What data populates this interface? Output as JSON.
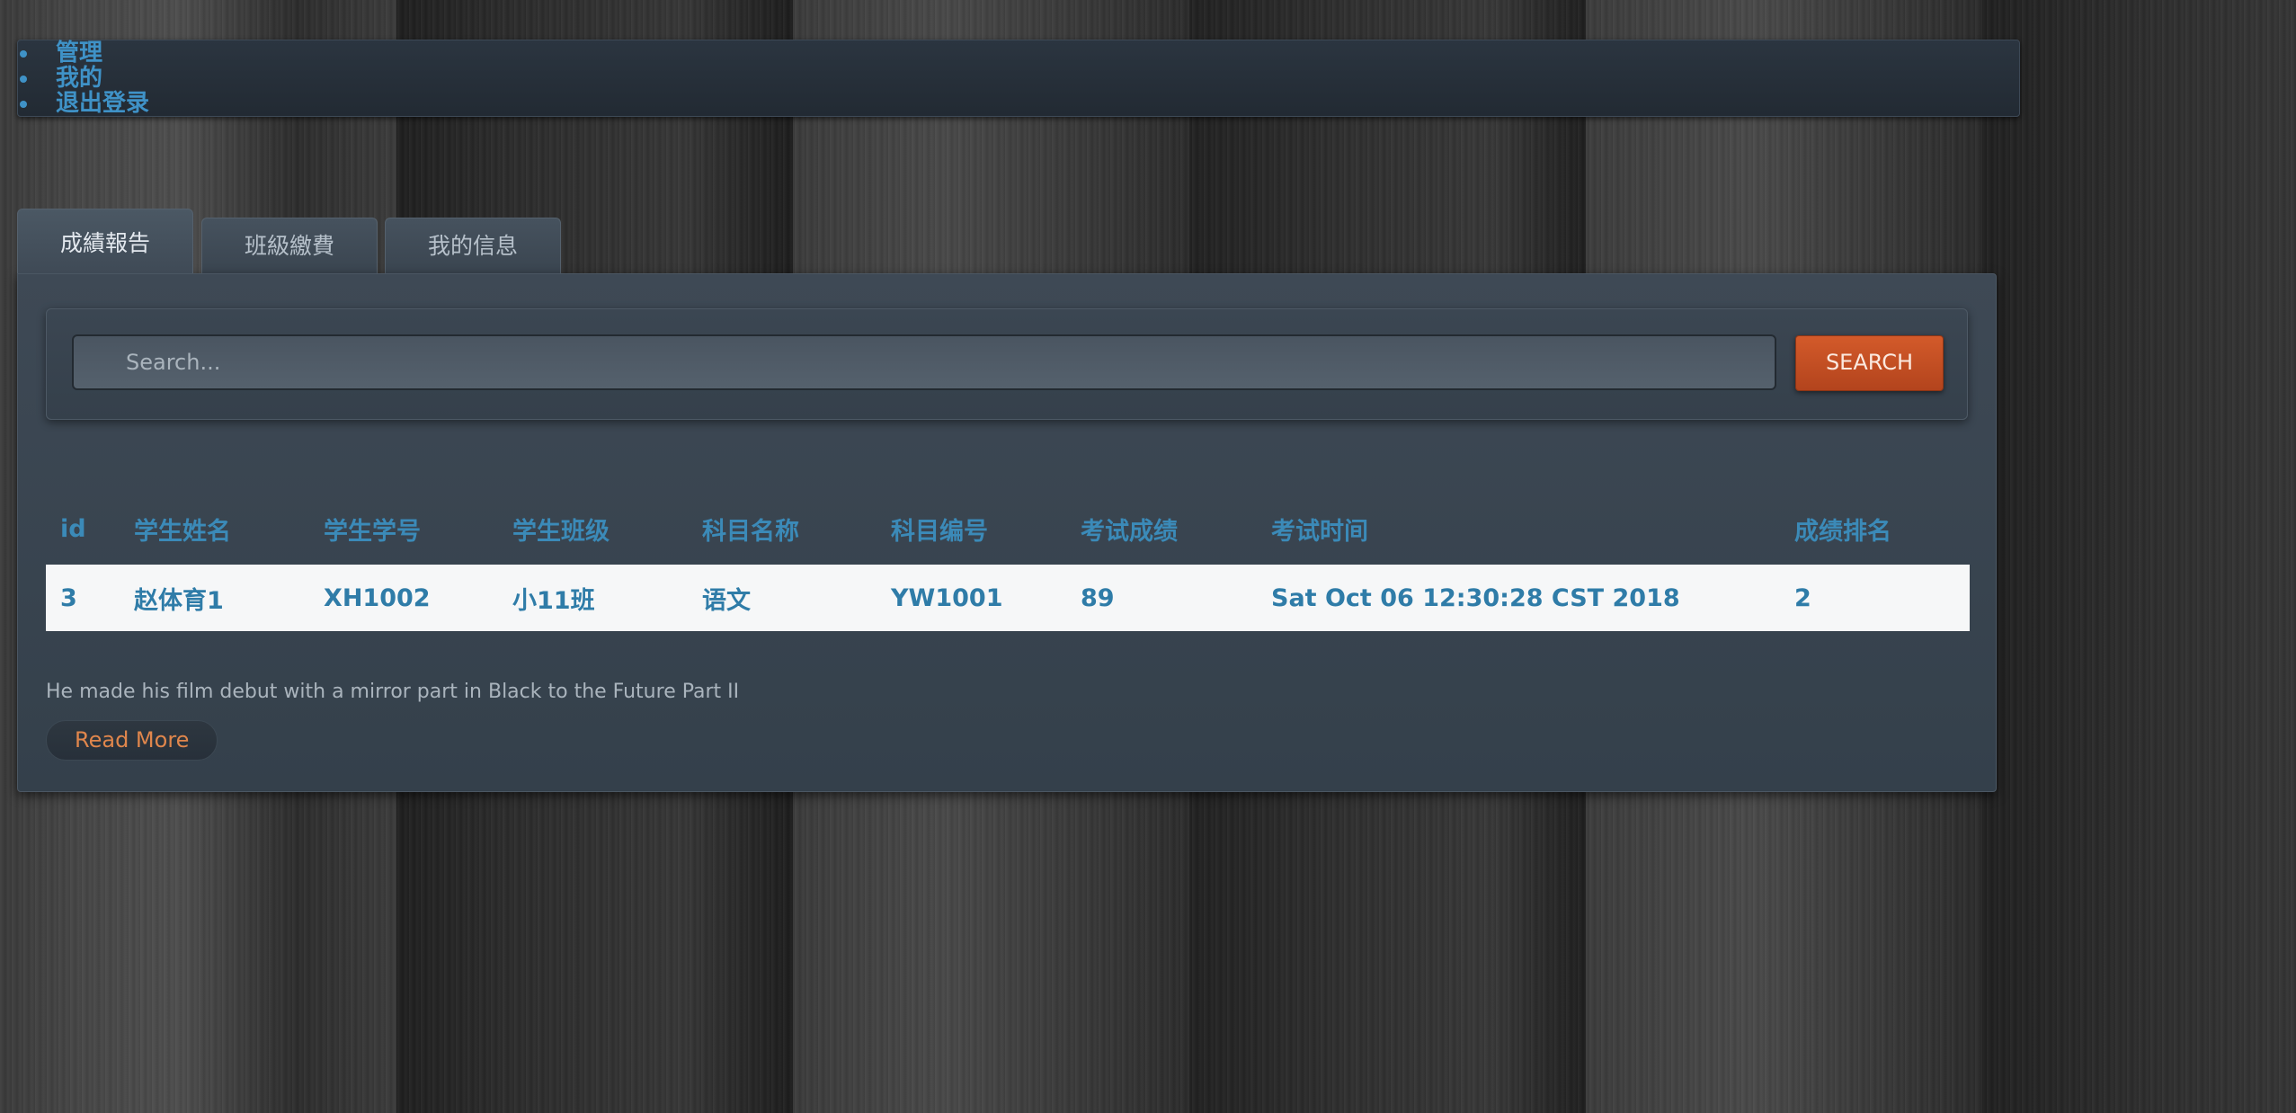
{
  "nav": {
    "items": [
      "管理",
      "我的",
      "退出登录"
    ]
  },
  "tabs": [
    {
      "label": "成績報告",
      "active": true
    },
    {
      "label": "班級繳費",
      "active": false
    },
    {
      "label": "我的信息",
      "active": false
    }
  ],
  "search": {
    "placeholder": "Search...",
    "value": "",
    "button_label": "SEARCH"
  },
  "table": {
    "headers": [
      "id",
      "学生姓名",
      "学生学号",
      "学生班级",
      "科目名称",
      "科目编号",
      "考试成绩",
      "考试时间",
      "成绩排名"
    ],
    "rows": [
      [
        "3",
        "赵体育1",
        "XH1002",
        "小11班",
        "语文",
        "YW1001",
        "89",
        "Sat Oct 06 12:30:28 CST 2018",
        "2"
      ]
    ]
  },
  "description": "He made his film debut with a mirror part in Black to the Future Part II",
  "read_more_label": "Read More",
  "colors": {
    "accent_blue": "#3b8ab8",
    "search_button": "#c4501f",
    "read_more_text": "#e0864c"
  }
}
